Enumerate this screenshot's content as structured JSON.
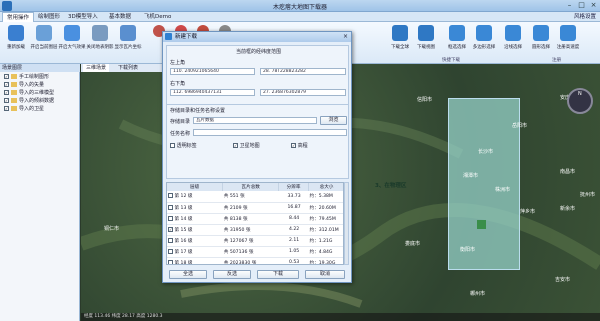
{
  "window": {
    "title": "木疙瘩大地图下载器"
  },
  "menu": {
    "tabs": [
      "常用操作",
      "绘制图形",
      "3D模型导入",
      "基本数据",
      "飞机Demo"
    ],
    "active": 0,
    "style_setting": "风格设置"
  },
  "ribbon": {
    "buttons": [
      {
        "label": "重新加载",
        "icon": "reload-icon",
        "color": "#3a7fd0"
      },
      {
        "label": "开启当前图层",
        "icon": "layer-icon",
        "color": "#6aa0d8"
      },
      {
        "label": "开启大气效果",
        "icon": "atmosphere-icon",
        "color": "#4a90e0"
      },
      {
        "label": "关闭地表阴影",
        "icon": "shadow-icon",
        "color": "#7a9bc0"
      },
      {
        "label": "显示瓦片坐标",
        "icon": "tile-icon",
        "color": "#5a8fcf"
      },
      {
        "label": "",
        "icon": "tool-icon",
        "color": "#c0524a"
      },
      {
        "label": "",
        "icon": "tool-icon",
        "color": "#d04a4a"
      },
      {
        "label": "",
        "icon": "tool-icon",
        "color": "#c24c3e"
      },
      {
        "label": "",
        "icon": "tool-icon",
        "color": "#8a8a8a"
      },
      {
        "label": "下载全球",
        "icon": "globe-download-icon",
        "color": "#2f78c4"
      },
      {
        "label": "下载视图",
        "icon": "view-download-icon",
        "color": "#2f78c4"
      },
      {
        "label": "框选选择",
        "icon": "rect-select-icon",
        "color": "#3a88d6"
      },
      {
        "label": "多边形选择",
        "icon": "polygon-select-icon",
        "color": "#3a88d6"
      },
      {
        "label": "沿线选择",
        "icon": "line-select-icon",
        "color": "#3a88d6"
      },
      {
        "label": "圆形选择",
        "icon": "circle-select-icon",
        "color": "#3a88d6"
      },
      {
        "label": "注册高速度",
        "icon": "register-icon",
        "color": "#3a88d6"
      }
    ],
    "group_labels": [
      "快捷下载",
      "注册"
    ]
  },
  "left_panel": {
    "header": "场景图层",
    "items": [
      {
        "label": "手工绘制图形",
        "checked": true
      },
      {
        "label": "导入的矢量",
        "checked": true
      },
      {
        "label": "导入的三维模型",
        "checked": true
      },
      {
        "label": "导入的倾斜数据",
        "checked": true
      },
      {
        "label": "导入的卫星",
        "checked": true
      }
    ]
  },
  "map": {
    "tabs": [
      "三维场景",
      "下载列表"
    ],
    "cities": [
      "信阳市",
      "安庆市",
      "长沙市",
      "南昌市",
      "湘潭市",
      "株洲市",
      "萍乡市",
      "新余市",
      "抚州市",
      "衡阳市",
      "娄底市",
      "郴州市",
      "吉安市",
      "铜仁市",
      "岳阳市"
    ],
    "annotation": "3、在物理区",
    "status": "经度 113.46 纬度 28.17 高度 1280.3"
  },
  "dialog": {
    "title": "新建下载",
    "range_label": "当前框的经纬度范围",
    "top_left_label": "左上角",
    "top_left_lon": "110. 240921065640",
    "top_left_lat": "28. 78T228823282",
    "bottom_right_label": "右下角",
    "bottom_right_lon": "112. 6986940437131",
    "bottom_right_lat": "27. 236876302879",
    "storage_section": "存储目录和任务名称设置",
    "storage_label": "存储目录",
    "storage_value": "瓦片数据",
    "browse": "浏览",
    "task_label": "任务名称",
    "task_value": "",
    "options": [
      {
        "label": "透明标签",
        "checked": false
      },
      {
        "label": "卫星地图",
        "checked": true
      },
      {
        "label": "高程",
        "checked": true
      }
    ],
    "grid_headers": [
      "层级",
      "瓦片总数",
      "分辨率",
      "总大小"
    ],
    "grid_rows": [
      {
        "level": "第 12 级",
        "count": "共 551 张",
        "res": "33.73",
        "size": "约：5.38M",
        "checked": false
      },
      {
        "level": "第 13 级",
        "count": "共 2109 张",
        "res": "16.87",
        "size": "约：20.60M",
        "checked": false
      },
      {
        "level": "第 14 级",
        "count": "共 8138 张",
        "res": "8.44",
        "size": "约：79.45M",
        "checked": false
      },
      {
        "level": "第 15 级",
        "count": "共 31950 张",
        "res": "4.22",
        "size": "约：312.01M",
        "checked": true
      },
      {
        "level": "第 16 级",
        "count": "共 127067 张",
        "res": "2.11",
        "size": "约：1.21G",
        "checked": false
      },
      {
        "level": "第 17 级",
        "count": "共 507136 张",
        "res": "1.05",
        "size": "约：4.84G",
        "checked": false
      },
      {
        "level": "第 18 级",
        "count": "共 2023830 张",
        "res": "0.53",
        "size": "约：19.30G",
        "checked": false
      }
    ],
    "buttons": [
      "全选",
      "反选",
      "下载",
      "取消"
    ]
  }
}
